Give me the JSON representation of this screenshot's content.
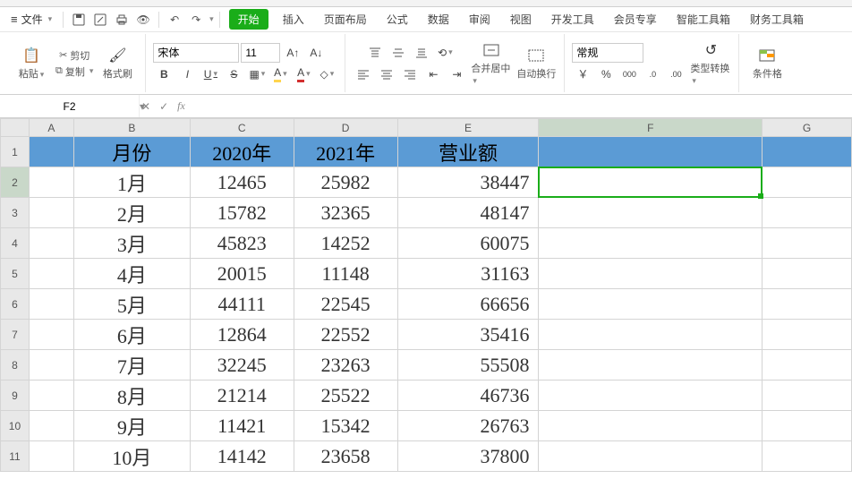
{
  "menu": {
    "file": "文件",
    "tabs": [
      "开始",
      "插入",
      "页面布局",
      "公式",
      "数据",
      "审阅",
      "视图",
      "开发工具",
      "会员专享",
      "智能工具箱",
      "财务工具箱"
    ]
  },
  "ribbon": {
    "clipboard": {
      "cut": "剪切",
      "copy": "复制",
      "paste": "粘贴",
      "format_painter": "格式刷"
    },
    "font": {
      "name": "宋体",
      "size": "11"
    },
    "align": {
      "merge_center": "合并居中",
      "wrap": "自动换行"
    },
    "number": {
      "format": "常规"
    },
    "type_convert": "类型转换",
    "cond_format": "条件格"
  },
  "namebox": "F2",
  "columns": [
    "A",
    "B",
    "C",
    "D",
    "E",
    "F",
    "G"
  ],
  "header_row": {
    "B": "月份",
    "C": "2020年",
    "D": "2021年",
    "E": "营业额"
  },
  "rows": [
    {
      "n": 2,
      "B": "1月",
      "C": "12465",
      "D": "25982",
      "E": "38447"
    },
    {
      "n": 3,
      "B": "2月",
      "C": "15782",
      "D": "32365",
      "E": "48147"
    },
    {
      "n": 4,
      "B": "3月",
      "C": "45823",
      "D": "14252",
      "E": "60075"
    },
    {
      "n": 5,
      "B": "4月",
      "C": "20015",
      "D": "11148",
      "E": "31163"
    },
    {
      "n": 6,
      "B": "5月",
      "C": "44111",
      "D": "22545",
      "E": "66656"
    },
    {
      "n": 7,
      "B": "6月",
      "C": "12864",
      "D": "22552",
      "E": "35416"
    },
    {
      "n": 8,
      "B": "7月",
      "C": "32245",
      "D": "23263",
      "E": "55508"
    },
    {
      "n": 9,
      "B": "8月",
      "C": "21214",
      "D": "25522",
      "E": "46736"
    },
    {
      "n": 10,
      "B": "9月",
      "C": "11421",
      "D": "15342",
      "E": "26763"
    },
    {
      "n": 11,
      "B": "10月",
      "C": "14142",
      "D": "23658",
      "E": "37800"
    }
  ],
  "icons": {
    "scissors": "✂",
    "copy": "⧉",
    "paste": "📋",
    "brush": "🖌",
    "currency": "￥",
    "percent": "%",
    "comma": "000",
    "dec_inc": ".00",
    "dec_dec": ".0"
  }
}
